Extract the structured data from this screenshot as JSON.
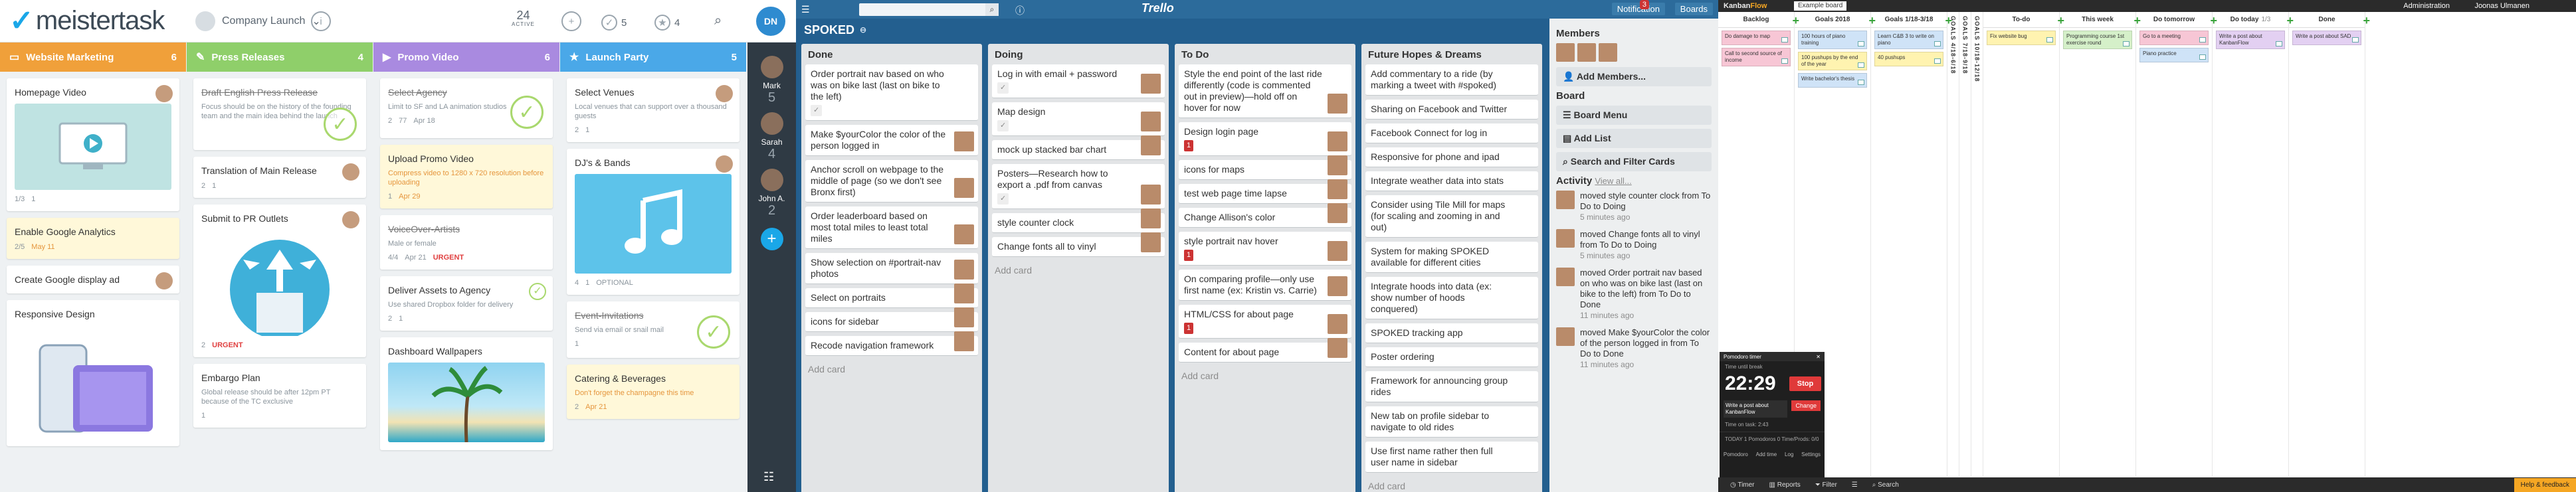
{
  "meistertask": {
    "logo": "meistertask",
    "project": "Company Launch",
    "active_count": "24",
    "active_label": "ACTIVE",
    "count_done": "5",
    "count_star": "4",
    "user_initials": "DN",
    "columns": [
      {
        "name": "Website Marketing",
        "count": "6",
        "color": "#f0a03a",
        "icon": "▭",
        "cards": [
          {
            "title": "Homepage Video",
            "style": "normal",
            "image": "video",
            "meta": [
              "1/3",
              "1"
            ]
          },
          {
            "title": "Enable Google Analytics",
            "style": "yellow",
            "meta_date": "May 11",
            "meta": [
              "2/5"
            ]
          },
          {
            "title": "Create Google display ad",
            "style": "normal"
          },
          {
            "title": "Responsive Design",
            "style": "normal",
            "image": "devices"
          }
        ]
      },
      {
        "name": "Press Releases",
        "count": "4",
        "color": "#8fcf6a",
        "icon": "✎",
        "cards": [
          {
            "title": "Draft English Press Release",
            "style": "strike",
            "desc": "Focus should be on the history of the founding team and the main idea behind the launch",
            "done": true
          },
          {
            "title": "Translation of Main Release",
            "style": "normal",
            "meta": [
              "2",
              "1"
            ]
          },
          {
            "title": "Submit to PR Outlets",
            "style": "normal",
            "image": "upload",
            "meta": [
              "2"
            ],
            "urgent": "URGENT"
          },
          {
            "title": "Embargo Plan",
            "style": "normal",
            "desc": "Global release should be after 12pm PT because of the TC exclusive",
            "meta": [
              "1"
            ]
          }
        ]
      },
      {
        "name": "Promo Video",
        "count": "6",
        "color": "#a98ae0",
        "icon": "▶",
        "cards": [
          {
            "title": "Select Agency",
            "style": "strike",
            "desc": "Limit to SF and LA animation studios",
            "meta_date": "Apr 18",
            "meta": [
              "2",
              "77"
            ],
            "done": true
          },
          {
            "title": "Upload Promo Video",
            "style": "yellow",
            "desc": "Compress video to 1280 x 720 resolution before uploading",
            "meta_date": "Apr 29",
            "meta": [
              "1"
            ]
          },
          {
            "title": "VoiceOver-Artists",
            "style": "strike",
            "desc": "Male or female",
            "meta_date": "Apr 21",
            "meta": [
              "4/4"
            ],
            "urgent": "URGENT"
          },
          {
            "title": "Deliver Assets to Agency",
            "style": "normal",
            "desc": "Use shared Dropbox folder for delivery",
            "meta": [
              "2",
              "1"
            ]
          },
          {
            "title": "Dashboard Wallpapers",
            "style": "normal",
            "image": "beach"
          }
        ]
      },
      {
        "name": "Launch Party",
        "count": "5",
        "color": "#4aa8e8",
        "icon": "★",
        "cards": [
          {
            "title": "Select Venues",
            "style": "normal",
            "desc": "Local venues that can support over a thousand guests",
            "meta": [
              "2",
              "1"
            ]
          },
          {
            "title": "DJ's & Bands",
            "style": "normal",
            "image": "music",
            "meta": [
              "4",
              "1"
            ],
            "optional": "OPTIONAL"
          },
          {
            "title": "Event-Invitations",
            "style": "strike",
            "desc": "Send via email or snail mail",
            "meta": [
              "1"
            ],
            "done": true
          },
          {
            "title": "Catering & Beverages",
            "style": "yellow",
            "desc": "Don't forget the champagne this time",
            "meta_date": "Apr 21",
            "meta": [
              "2"
            ]
          }
        ]
      }
    ],
    "side_users": [
      {
        "name": "Mark",
        "count": "5"
      },
      {
        "name": "Sarah",
        "count": "4"
      },
      {
        "name": "John A.",
        "count": "2"
      }
    ]
  },
  "trello": {
    "logo": "Trello",
    "board_title": "SPOKED",
    "notifications_label": "Notification",
    "notifications_count": "3",
    "boards_label": "Boards",
    "lists": [
      {
        "name": "Done",
        "cards": [
          {
            "text": "Order portrait nav based on who was on bike last (last on bike to the left)",
            "check": "✓"
          },
          {
            "text": "Make $yourColor the color of the person logged in",
            "photo": true
          },
          {
            "text": "Anchor scroll on webpage to the middle of page (so we don't see Bronx first)",
            "photo": true
          },
          {
            "text": "Order leaderboard based on most total miles to least total miles",
            "photo": true
          },
          {
            "text": "Show selection on #portrait-nav photos",
            "photo": true
          },
          {
            "text": "Select on portraits",
            "photo": true
          },
          {
            "text": "icons for sidebar",
            "photo": true
          },
          {
            "text": "Recode navigation framework",
            "photo": true
          }
        ],
        "add": "Add card"
      },
      {
        "name": "Doing",
        "cards": [
          {
            "text": "Log in with email + password",
            "check": "✓",
            "photo": true
          },
          {
            "text": "Map design",
            "check": "✓",
            "photo": true
          },
          {
            "text": "mock up stacked bar chart",
            "photo": true
          },
          {
            "text": "Posters—Research how to export a .pdf from canvas",
            "check": "✓",
            "photo": true
          },
          {
            "text": "style counter clock",
            "photo": true
          },
          {
            "text": "Change fonts all to vinyl",
            "photo": true
          }
        ],
        "add": "Add card"
      },
      {
        "name": "To Do",
        "cards": [
          {
            "text": "Style the end point of the last ride differently (code is commented out in preview)—hold off on hover for now",
            "photo": true
          },
          {
            "text": "Design login page",
            "comments": "1",
            "photo": true
          },
          {
            "text": "icons for maps",
            "photo": true
          },
          {
            "text": "test web page time lapse",
            "photo": true
          },
          {
            "text": "Change Allison's color",
            "photo": true
          },
          {
            "text": "style portrait nav hover",
            "comments": "1",
            "photo": true
          },
          {
            "text": "On comparing profile—only use first name (ex: Kristin vs. Carrie)",
            "photo": true
          },
          {
            "text": "HTML/CSS for about page",
            "comments": "1",
            "photo": true
          },
          {
            "text": "Content for about page",
            "photo": true
          }
        ],
        "add": "Add card"
      },
      {
        "name": "Future Hopes & Dreams",
        "cards": [
          {
            "text": "Add commentary to a ride (by marking a tweet with #spoked)"
          },
          {
            "text": "Sharing on Facebook and Twitter"
          },
          {
            "text": "Facebook Connect for log in"
          },
          {
            "text": "Responsive for phone and ipad"
          },
          {
            "text": "Integrate weather data into stats"
          },
          {
            "text": "Consider using Tile Mill for maps (for scaling and zooming in and out)"
          },
          {
            "text": "System for making SPOKED available for different cities"
          },
          {
            "text": "Integrate hoods into data (ex: show number of hoods conquered)"
          },
          {
            "text": "SPOKED tracking app"
          },
          {
            "text": "Poster ordering"
          },
          {
            "text": "Framework for announcing group rides"
          },
          {
            "text": "New tab on profile sidebar to navigate to old rides"
          },
          {
            "text": "Use first name rather then full user name in sidebar"
          }
        ],
        "add": "Add card"
      }
    ],
    "sidebar": {
      "members_title": "Members",
      "add_members": "Add Members...",
      "board_title": "Board",
      "board_menu": "Board Menu",
      "add_list": "Add List",
      "search_filter": "Search and Filter Cards",
      "activity_title": "Activity",
      "view_all": "View all...",
      "activity": [
        {
          "text": "moved style counter clock from To Do to Doing",
          "time": "5 minutes ago"
        },
        {
          "text": "moved Change fonts all to vinyl from To Do to Doing",
          "time": "5 minutes ago"
        },
        {
          "text": "moved Order portrait nav based on who was on bike last (last on bike to the left) from To Do to Done",
          "time": "11 minutes ago"
        },
        {
          "text": "moved Make $yourColor the color of the person logged in from To Do to Done",
          "time": "11 minutes ago"
        }
      ]
    }
  },
  "kanbanflow": {
    "logo_a": "Kanban",
    "logo_b": "Flow",
    "board": "Example board",
    "admin": "Administration",
    "user": "Joonas Ulmanen",
    "columns": [
      {
        "name": "Backlog",
        "tasks": [
          {
            "t": "Do damage to map",
            "c": "#f7c6d5"
          },
          {
            "t": "Call to second source of income",
            "c": "#f7c6d5"
          }
        ]
      },
      {
        "name": "Goals 2018",
        "tasks": [
          {
            "t": "100 hours of piano training",
            "c": "#cfe3f7"
          },
          {
            "t": "100 pushups by the end of the year",
            "c": "#fff3b0"
          },
          {
            "t": "Write bachelor's thesis",
            "c": "#cfe3f7"
          }
        ]
      },
      {
        "name": "Goals 1/18-3/18",
        "tasks": [
          {
            "t": "Learn C&B 3 to write on piano",
            "c": "#cfe3f7"
          },
          {
            "t": "40 pushups",
            "c": "#fff3b0"
          }
        ]
      },
      {
        "name": "GOALS 4/18-6/18",
        "narrow": true
      },
      {
        "name": "GOALS 7/18-9/18",
        "narrow": true
      },
      {
        "name": "GOALS 10/18-12/18",
        "narrow": true
      },
      {
        "name": "To-do",
        "tasks": [
          {
            "t": "Fix website bug",
            "c": "#fff3b0"
          }
        ]
      },
      {
        "name": "This week",
        "tasks": [
          {
            "t": "Programming course 1st exercise round",
            "c": "#d5f0c9"
          }
        ]
      },
      {
        "name": "Do tomorrow",
        "tasks": [
          {
            "t": "Go to a meeting",
            "c": "#f7c6d5"
          },
          {
            "t": "Piano practice",
            "c": "#cfe3f7"
          }
        ]
      },
      {
        "name": "Do today",
        "extra": "1/3",
        "tasks": [
          {
            "t": "Write a post about KanbanFlow",
            "c": "#e3d0f2"
          }
        ]
      },
      {
        "name": "Done",
        "tasks": [
          {
            "t": "Write a post about SAD",
            "c": "#e3d0f2"
          }
        ]
      }
    ],
    "pomodoro": {
      "title": "Pomodoro timer",
      "label": "Time until break",
      "time": "22:29",
      "stop": "Stop",
      "task": "Write a post about KanbanFlow",
      "change": "Change",
      "remaining": "Time on task: 2:43",
      "today": "TODAY  1  Pomodoros  0  Time/Prods: 0/0",
      "foot": [
        "Pomodoro",
        "Add time",
        "Log",
        "Settings"
      ]
    },
    "bottom": [
      "Timer",
      "Reports",
      "Filter",
      "Search"
    ],
    "help": "Help & feedback"
  }
}
